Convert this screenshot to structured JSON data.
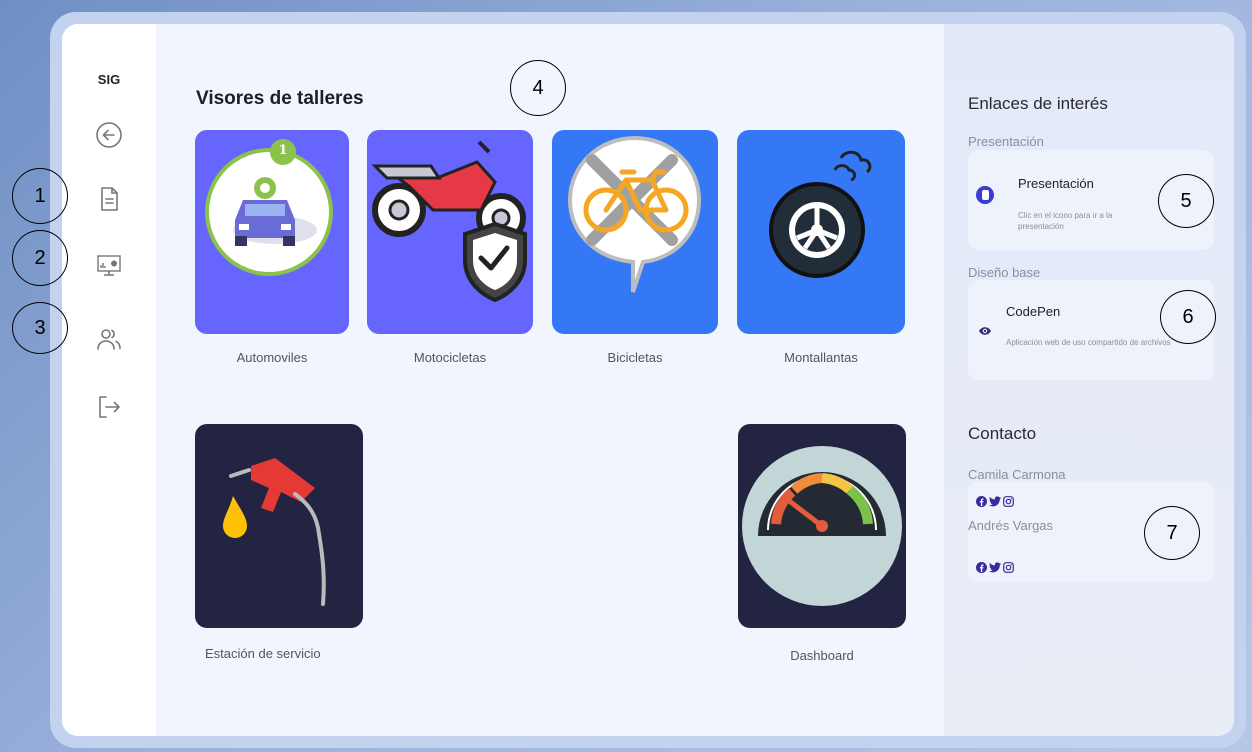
{
  "sidebar": {
    "brand": "SIG",
    "nav": [
      "back-icon",
      "document-icon",
      "monitor-chart-icon",
      "users-icon",
      "logout-icon"
    ]
  },
  "main": {
    "title": "Visores de talleres",
    "cards": [
      {
        "label": "Automoviles",
        "badge": "1"
      },
      {
        "label": "Motocicletas"
      },
      {
        "label": "Bicicletas"
      },
      {
        "label": "Montallantas"
      },
      {
        "label": "Estación de servicio"
      },
      {
        "label": "Dashboard"
      }
    ]
  },
  "right": {
    "links_title": "Enlaces de interés",
    "presentation_section": "Presentación",
    "presentation_title": "Presentación",
    "presentation_desc": "Clic en el icono para ir a la presentación",
    "base_section": "Diseño base",
    "codepen_title": "CodePen",
    "codepen_desc": "Aplicación web de uso compartido de archivos",
    "contact_title": "Contacto",
    "contacts": [
      {
        "name": "Camila Carmona"
      },
      {
        "name": "Andrés Vargas"
      }
    ]
  },
  "annotations": [
    "1",
    "2",
    "3",
    "4",
    "5",
    "6",
    "7"
  ],
  "colors": {
    "card_purple": "#6666ff",
    "card_blue": "#3478f6",
    "card_navy": "#232342",
    "accent": "#3b3bd6"
  }
}
